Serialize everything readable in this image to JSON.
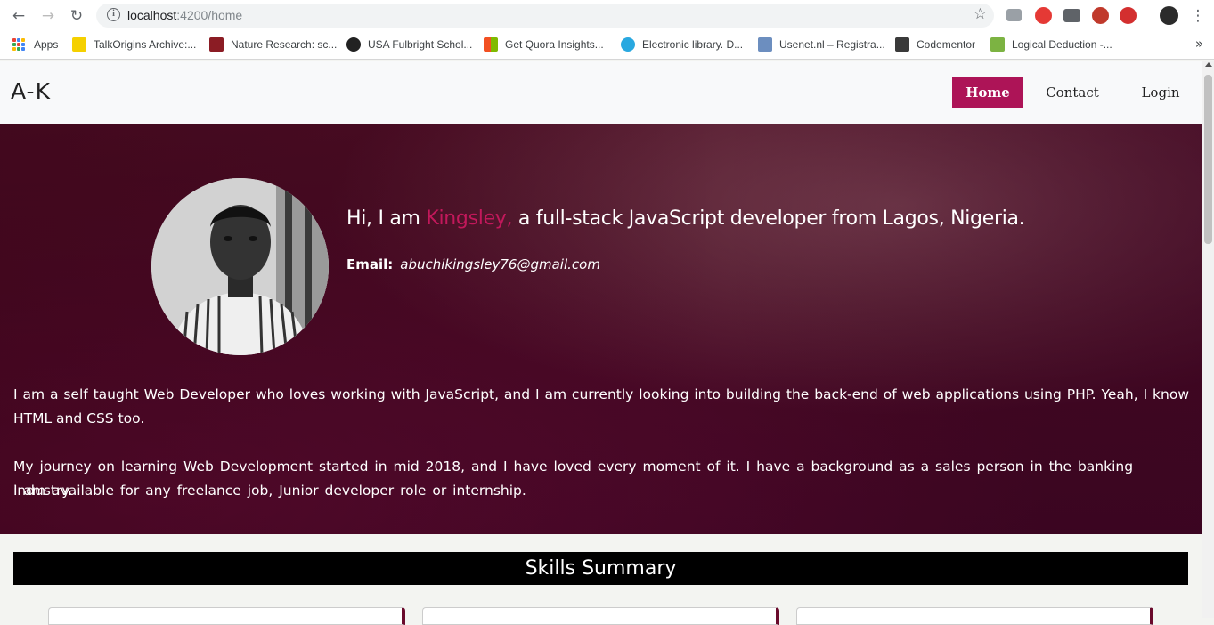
{
  "browser": {
    "url_host": "localhost",
    "url_rest": ":4200/home",
    "bookmarks": [
      {
        "label": "Apps"
      },
      {
        "label": "TalkOrigins Archive:..."
      },
      {
        "label": "Nature Research: sc..."
      },
      {
        "label": "USA Fulbright Schol..."
      },
      {
        "label": "Get Quora Insights..."
      },
      {
        "label": "Electronic library. D..."
      },
      {
        "label": "Usenet.nl – Registra..."
      },
      {
        "label": "Codementor"
      },
      {
        "label": "Logical Deduction -..."
      }
    ],
    "more": "»"
  },
  "site": {
    "brand": "A-K",
    "nav": {
      "home": "Home",
      "contact": "Contact",
      "login": "Login"
    },
    "accent": "#ad1457"
  },
  "hero": {
    "greeting_pre": "Hi, I am ",
    "greeting_name": "Kingsley,",
    "greeting_post": " a full-stack JavaScript developer from Lagos, Nigeria.",
    "email_label": "Email:",
    "email": "abuchikingsley76@gmail.com",
    "bio_1": "I am a self taught Web Developer who loves working with JavaScript, and I am currently looking into building the back-end of web applications using PHP. Yeah, I know HTML and CSS too.",
    "bio_2": "My journey on learning Web Development started in mid 2018, and I have loved every moment of it. I have a background as a sales person in the banking industry.",
    "bio_3": "I am available for any freelance job, Junior developer role or internship."
  },
  "skills": {
    "title": "Skills Summary"
  }
}
